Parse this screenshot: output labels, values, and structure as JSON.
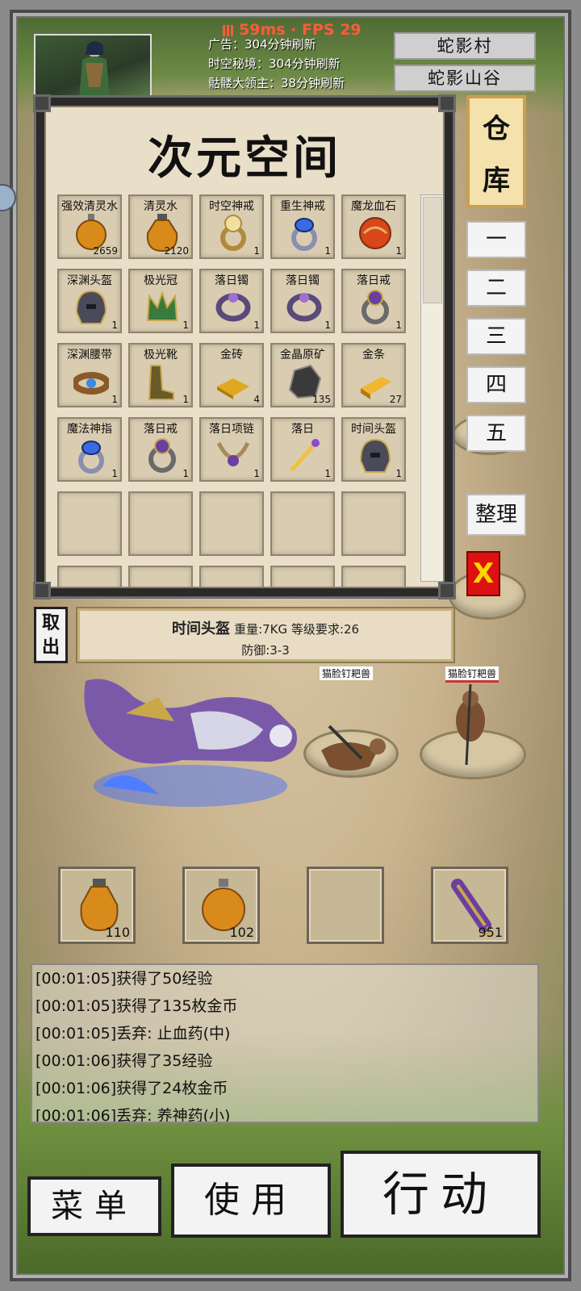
{
  "hud": {
    "latency": "59ms · FPS 29",
    "notices": [
      "广告：304分钟刷新",
      "时空秘境：304分钟刷新",
      "骷髅大领主：38分钟刷新"
    ],
    "locations": [
      "蛇影村",
      "蛇影山谷"
    ]
  },
  "warehouse": {
    "title": "次元空间",
    "side_title": "仓库",
    "tabs": [
      "一",
      "二",
      "三",
      "四",
      "五"
    ],
    "sort_label": "整理",
    "close_label": "X",
    "take_out_label": "取出",
    "items": [
      {
        "name": "强效清灵水",
        "count": "2659",
        "icon": "orange-potion-icon"
      },
      {
        "name": "清灵水",
        "count": "2120",
        "icon": "orange-flask-icon"
      },
      {
        "name": "时空神戒",
        "count": "1",
        "icon": "gold-ring-icon"
      },
      {
        "name": "重生神戒",
        "count": "1",
        "icon": "blue-ring-icon"
      },
      {
        "name": "魔龙血石",
        "count": "1",
        "icon": "red-orb-icon"
      },
      {
        "name": "深渊头盔",
        "count": "1",
        "icon": "helmet-icon"
      },
      {
        "name": "极光冠",
        "count": "1",
        "icon": "crown-icon"
      },
      {
        "name": "落日镯",
        "count": "1",
        "icon": "bracelet-icon"
      },
      {
        "name": "落日镯",
        "count": "1",
        "icon": "bracelet-icon"
      },
      {
        "name": "落日戒",
        "count": "1",
        "icon": "ring-icon"
      },
      {
        "name": "深渊腰带",
        "count": "1",
        "icon": "belt-icon"
      },
      {
        "name": "极光靴",
        "count": "1",
        "icon": "boots-icon"
      },
      {
        "name": "金砖",
        "count": "4",
        "icon": "gold-brick-icon"
      },
      {
        "name": "金晶原矿",
        "count": "135",
        "icon": "ore-icon"
      },
      {
        "name": "金条",
        "count": "27",
        "icon": "gold-bar-icon"
      },
      {
        "name": "魔法神指",
        "count": "1",
        "icon": "blue-ring-icon"
      },
      {
        "name": "落日戒",
        "count": "1",
        "icon": "ring-icon"
      },
      {
        "name": "落日项链",
        "count": "1",
        "icon": "necklace-icon"
      },
      {
        "name": "落日",
        "count": "1",
        "icon": "sword-icon"
      },
      {
        "name": "时间头盔",
        "count": "1",
        "icon": "helmet-icon"
      }
    ],
    "empty_slots": 10,
    "scroll_position": 0
  },
  "tooltip": {
    "name": "时间头盔",
    "meta": "重量:7KG 等级要求:26",
    "stats": "防御:3-3"
  },
  "monsters": [
    "猫脸钉耙兽",
    "猫脸钉耙兽"
  ],
  "quickbar": [
    {
      "count": "110",
      "icon": "orange-flask-icon"
    },
    {
      "count": "102",
      "icon": "orange-potion-icon"
    },
    {
      "count": "",
      "icon": ""
    },
    {
      "count": "951",
      "icon": "scroll-icon"
    }
  ],
  "log": [
    "[00:01:05]获得了50经验",
    "[00:01:05]获得了135枚金币",
    "[00:01:05]丢弃: 止血药(中)",
    "[00:01:06]获得了35经验",
    "[00:01:06]获得了24枚金币",
    "[00:01:06]丢弃: 养神药(小)"
  ],
  "buttons": {
    "menu": "菜单",
    "use": "使用",
    "action": "行动"
  },
  "colors": {
    "latency": "#ff5a3a",
    "close": "#dd1111",
    "parchment": "#e9dfc8"
  }
}
